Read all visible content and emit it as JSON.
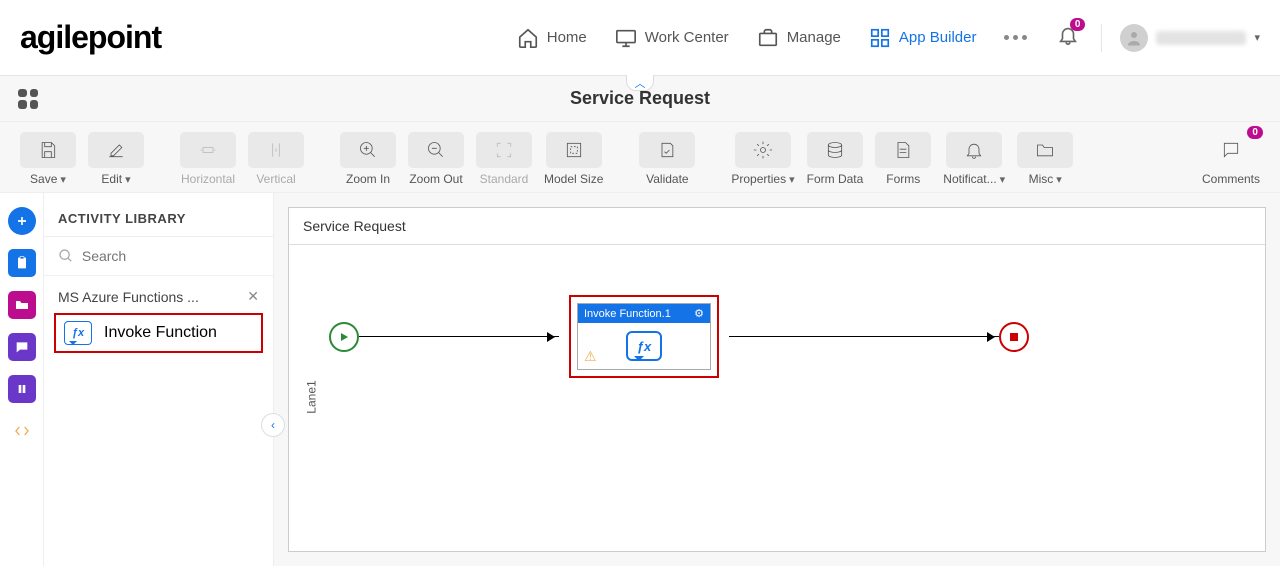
{
  "logo_text": "agilepoint",
  "nav": {
    "home": "Home",
    "work_center": "Work Center",
    "manage": "Manage",
    "app_builder": "App Builder"
  },
  "notifications_count": "0",
  "subheader_title": "Service Request",
  "toolbar": {
    "save": "Save",
    "edit": "Edit",
    "horizontal": "Horizontal",
    "vertical": "Vertical",
    "zoom_in": "Zoom In",
    "zoom_out": "Zoom Out",
    "standard": "Standard",
    "model_size": "Model Size",
    "validate": "Validate",
    "properties": "Properties",
    "form_data": "Form Data",
    "forms": "Forms",
    "notifications": "Notificat...",
    "misc": "Misc",
    "comments": "Comments",
    "comments_count": "0"
  },
  "library": {
    "header": "ACTIVITY LIBRARY",
    "search_placeholder": "Search",
    "category": "MS Azure Functions ...",
    "item1": "Invoke Function"
  },
  "canvas": {
    "title": "Service Request",
    "lane": "Lane1",
    "activity_title": "Invoke Function.1"
  }
}
